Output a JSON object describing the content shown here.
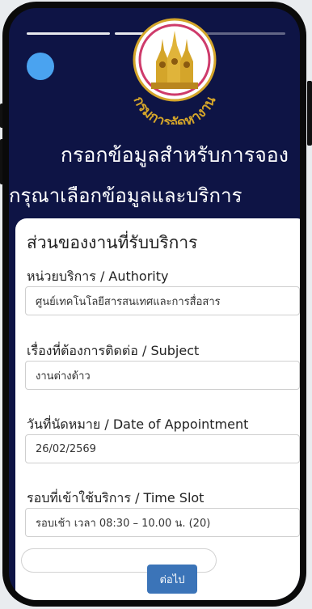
{
  "logo": {
    "text": "กรมการจัดหางาน",
    "icon": "department-of-employment-seal"
  },
  "header": {
    "title": "กรอกข้อมูลสำหรับการจอง",
    "subtitle": "กรุณาเลือกข้อมูลและบริการ"
  },
  "form": {
    "heading": "ส่วนของงานที่รับบริการ",
    "fields": [
      {
        "label": "หน่วยบริการ / Authority",
        "value": "ศูนย์เทคโนโลยีสารสนเทศและการสื่อสาร"
      },
      {
        "label": "เรื่องที่ต้องการติดต่อ / Subject",
        "value": "งานต่างด้าว"
      },
      {
        "label": "วันที่นัดหมาย / Date of Appointment",
        "value": "26/02/2569"
      },
      {
        "label": "รอบที่เข้าใช้บริการ / Time Slot",
        "value": "รอบเช้า เวลา 08:30 – 10.00 น. (20)"
      }
    ],
    "next_button": "ต่อไป"
  },
  "colors": {
    "header_bg": "#0e1445",
    "accent_blue": "#3b74b8",
    "avatar_blue": "#4aa3f0",
    "logo_gold": "#d4a52a"
  },
  "icons": {
    "heart": "heart-icon",
    "send": "send-icon"
  }
}
